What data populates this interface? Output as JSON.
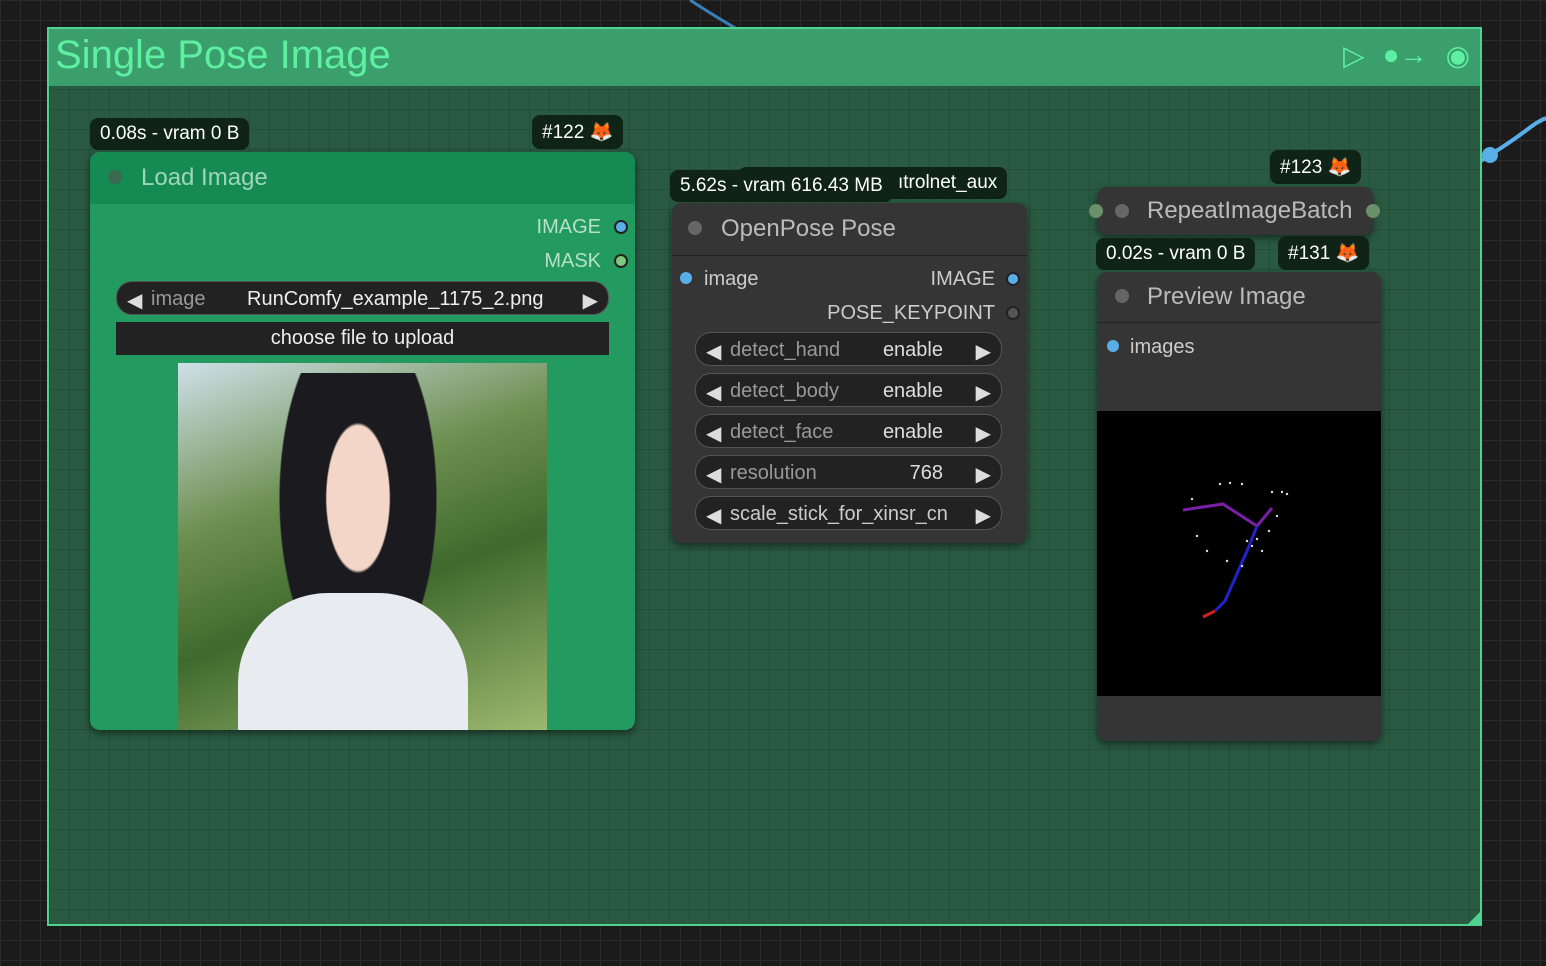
{
  "group": {
    "title": "Single Pose Image",
    "icons": [
      "play-icon",
      "bypass-icon",
      "eye-icon"
    ],
    "color": "#3a9e6d"
  },
  "load_image": {
    "id": "#122",
    "timing": "0.08s - vram 0 B",
    "title": "Load Image",
    "outputs": [
      "IMAGE",
      "MASK"
    ],
    "image_widget": {
      "label": "image",
      "value": "RunComfy_example_1175_2.png"
    },
    "upload_label": "choose file to upload"
  },
  "openpose": {
    "timing": "5.62s - vram 616.43 MB",
    "source_badge": "ıtrolnet_aux",
    "title": "OpenPose Pose",
    "input": "image",
    "outputs": [
      "IMAGE",
      "POSE_KEYPOINT"
    ],
    "widgets": [
      {
        "label": "detect_hand",
        "value": "enable"
      },
      {
        "label": "detect_body",
        "value": "enable"
      },
      {
        "label": "detect_face",
        "value": "enable"
      },
      {
        "label": "resolution",
        "value": "768"
      },
      {
        "label": "scale_stick_for_xinsr_cn",
        "value": ""
      }
    ]
  },
  "repeat": {
    "id": "#123",
    "title": "RepeatImageBatch"
  },
  "preview": {
    "id": "#131",
    "timing": "0.02s - vram 0 B",
    "title": "Preview Image",
    "input": "images"
  },
  "colors": {
    "link": "#5aaee8",
    "node": "#353535",
    "load_node": "#239a5f"
  }
}
